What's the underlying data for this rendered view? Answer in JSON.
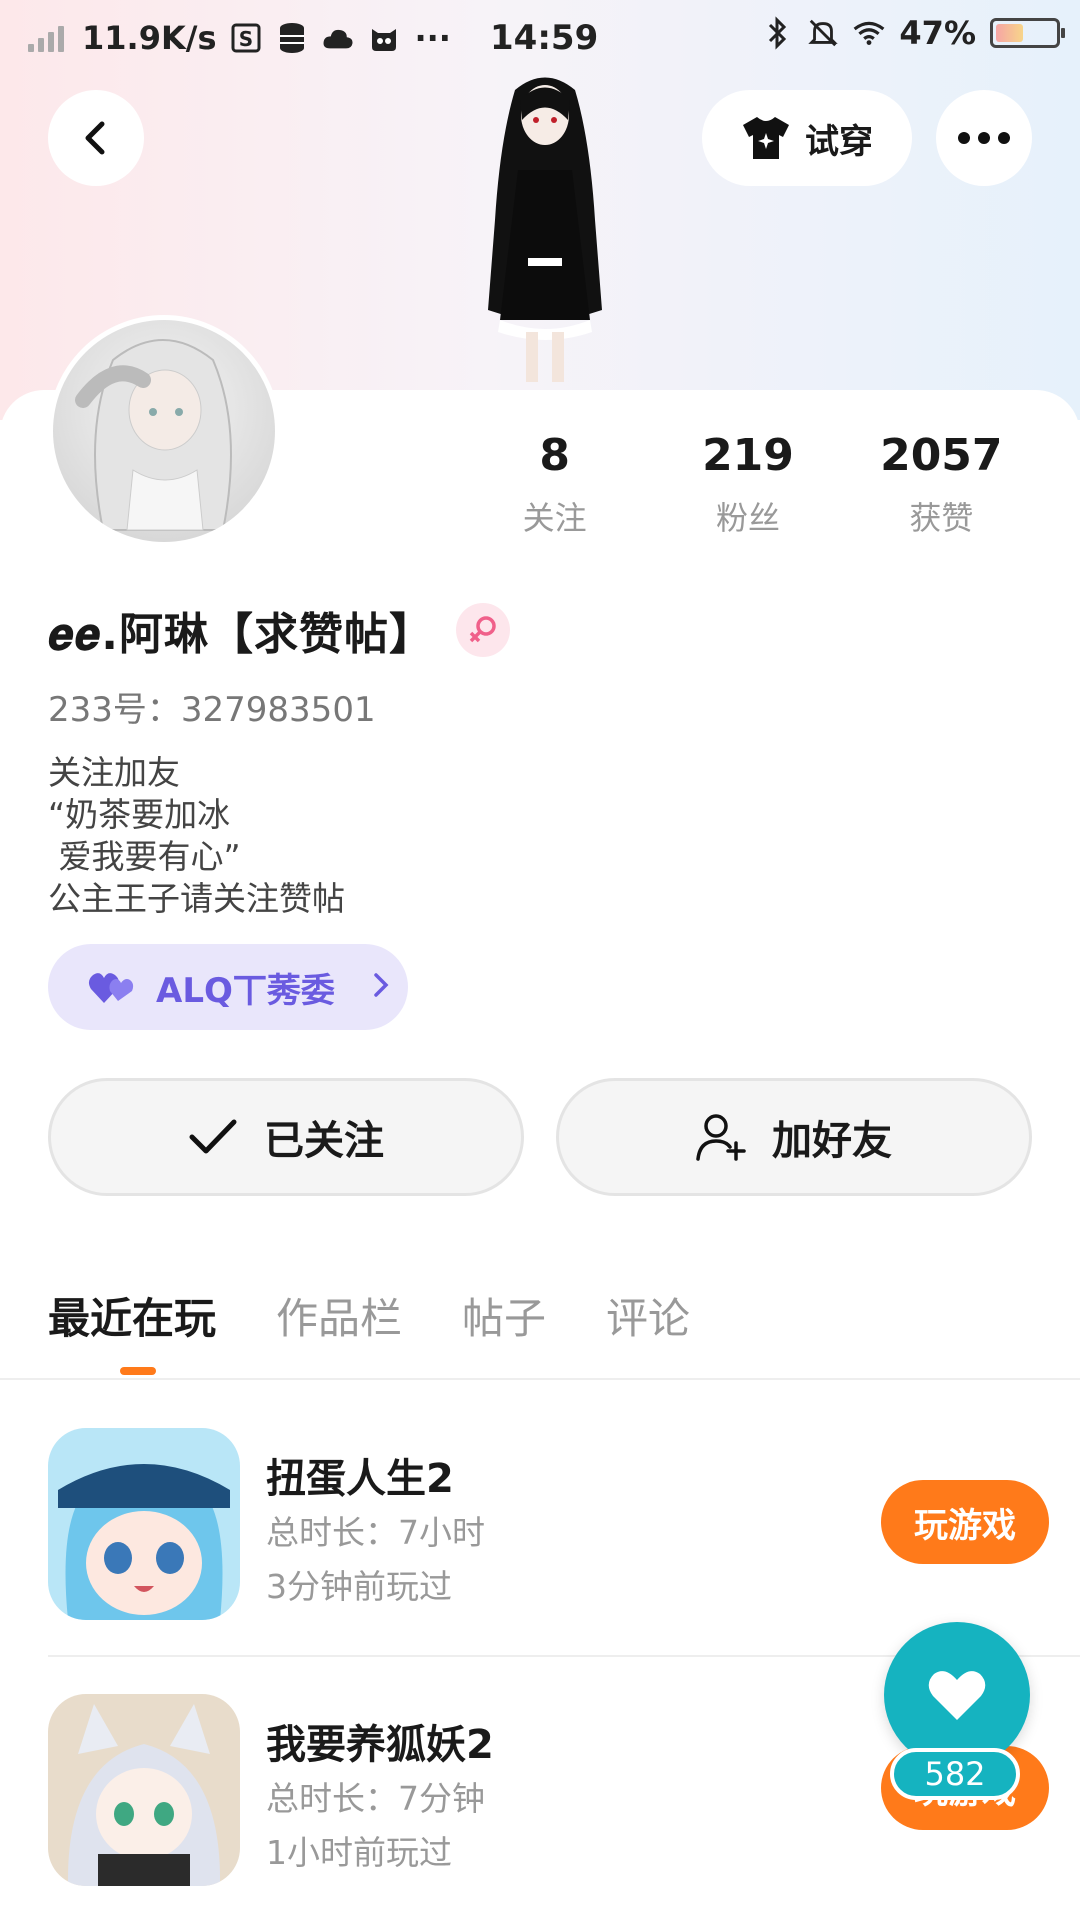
{
  "status_bar": {
    "net_speed": "11.9K/s",
    "time": "14:59",
    "battery_percent": "47%",
    "battery_level": 0.47,
    "more": "···"
  },
  "header": {
    "try_on_label": "试穿"
  },
  "profile": {
    "name": "𝒆𝒆.阿琳【求赞帖】",
    "uid": "233号：327983501",
    "bio_lines": [
      "关注加友",
      "“奶茶要加冰",
      " 爱我要有心”",
      "公主王子请关注赞帖"
    ],
    "badge_label": "ALQ丅莠委",
    "stats": [
      {
        "value": "8",
        "label": "关注"
      },
      {
        "value": "219",
        "label": "粉丝"
      },
      {
        "value": "2057",
        "label": "获赞"
      }
    ]
  },
  "actions": {
    "following_label": "已关注",
    "add_friend_label": "加好友"
  },
  "tabs": [
    "最近在玩",
    "作品栏",
    "帖子",
    "评论"
  ],
  "games": [
    {
      "title": "扭蛋人生2",
      "duration": "总时长：7小时",
      "last_played": "3分钟前玩过",
      "button": "玩游戏"
    },
    {
      "title": "我要养狐妖2",
      "duration": "总时长：7分钟",
      "last_played": "1小时前玩过",
      "button": "玩游戏"
    }
  ],
  "fab": {
    "count": "582"
  },
  "colors": {
    "accent_orange": "#ff7a1a",
    "fab_teal": "#15b3c0",
    "badge_purple": "#6a5be0"
  }
}
